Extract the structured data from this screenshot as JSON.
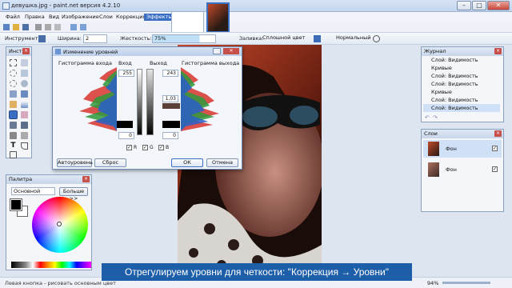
{
  "window": {
    "title": "девушка.jpg - paint.net версия 4.2.10"
  },
  "menu": [
    "Файл",
    "Правка",
    "Вид",
    "Изображение",
    "Слои",
    "Коррекция",
    "Эффекты"
  ],
  "toolbar": {
    "tool_label": "Инструмент:",
    "width_label": "Ширина:",
    "width_value": "2",
    "hardness_label": "Жесткость:",
    "hardness_value": "75%",
    "fill_label": "Заливка:",
    "fill_value": "Сплошной цвет",
    "blend_value": "Нормальный"
  },
  "tools_panel": {
    "title": "Инст..."
  },
  "palette_panel": {
    "title": "Палитра",
    "mode_value": "Основной",
    "more_label": "Больше >>"
  },
  "levels_dialog": {
    "title": "Изменение уровней",
    "input_hist_label": "Гистограмма входа",
    "input_label": "Вход",
    "output_label": "Выход",
    "output_hist_label": "Гистограмма выхода",
    "input_high": "255",
    "input_low": "0",
    "output_high": "243",
    "output_gamma": "1,03",
    "output_low": "0",
    "ch_r": "R",
    "ch_g": "G",
    "ch_b": "B",
    "auto_label": "Автоуровень",
    "reset_label": "Сброс",
    "ok_label": "ОК",
    "cancel_label": "Отмена"
  },
  "history_panel": {
    "title": "Журнал",
    "items": [
      "Слой: Видимость",
      "Кривые",
      "Слой: Видимость",
      "Слой: Видимость",
      "Кривые",
      "Слой: Видимость",
      "Слой: Видимость"
    ]
  },
  "layers_panel": {
    "title": "Слои",
    "layers": [
      "Фон",
      "Фон"
    ]
  },
  "status": {
    "hint": "Левая кнопка - рисовать основным цвет",
    "zoom": "94%"
  },
  "caption": "Отрегулируем уровни для четкости: \"Коррекция → Уровни\"",
  "colors": {
    "accent": "#3a6fc4",
    "caption_bg": "#1d5ea8"
  }
}
